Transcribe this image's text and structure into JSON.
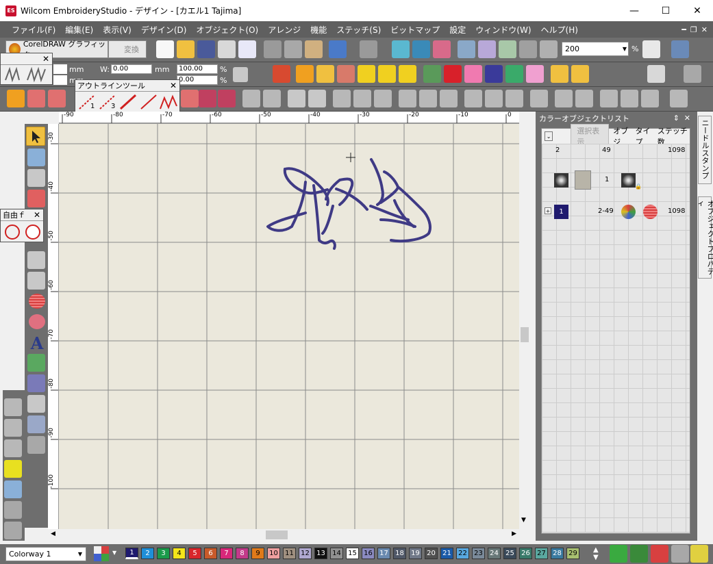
{
  "window": {
    "title": "Wilcom EmbroideryStudio - デザイン - [カエル1       Tajima]",
    "logo": "ES"
  },
  "menu": [
    "ファイル(F)",
    "編集(E)",
    "表示(V)",
    "デザイン(D)",
    "オブジェクト(O)",
    "アレンジ",
    "機能",
    "ステッチ(S)",
    "ビットマップ",
    "設定",
    "ウィンドウ(W)",
    "ヘルプ(H)"
  ],
  "toolbar": {
    "coreldraw_label": "CorelDRAW グラフィック",
    "convert_label": "変換",
    "zoom_value": "200",
    "zoom_unit": "%"
  },
  "props": {
    "unit1": "mm",
    "w_label": "W:",
    "w_value": "0.00",
    "unit2": "mm",
    "pct_value1": "100.00",
    "pct1": "%",
    "unit3": "mm",
    "val3": "0.00",
    "pct2": "%"
  },
  "outline_tools": {
    "title": "アウトラインツール",
    "num1": "1",
    "num2": "3"
  },
  "freehand": {
    "title": "自由ｆ"
  },
  "ruler": {
    "h_ticks": [
      "-90",
      "-80",
      "-70",
      "-60",
      "-50",
      "-40",
      "-30",
      "-20",
      "-10",
      "0"
    ],
    "v_ticks": [
      "-30",
      "-40",
      "-50",
      "-60",
      "-70",
      "-80",
      "-90",
      "-100"
    ]
  },
  "color_object_list": {
    "title": "カラーオブジェクトリスト",
    "filter_button": "選択表示",
    "columns": [
      "オブジ",
      "タイプ",
      "ステッチ数"
    ],
    "header_row": {
      "c1": "2",
      "c2": "49",
      "c3": "1098"
    },
    "row1": {
      "num": "1"
    },
    "row2": {
      "color_num": "1",
      "range": "2-49",
      "stitches": "1098"
    }
  },
  "side_tabs": [
    "ニードルスタンプ",
    "オブジェクトプロパティ"
  ],
  "status": {
    "colorway": "Colorway 1",
    "swatches": [
      {
        "n": "1",
        "c": "#1f1a6e",
        "fg": "#fff"
      },
      {
        "n": "2",
        "c": "#1f8fd8",
        "fg": "#fff"
      },
      {
        "n": "3",
        "c": "#1a9a4a",
        "fg": "#fff"
      },
      {
        "n": "4",
        "c": "#f4e51a",
        "fg": "#000"
      },
      {
        "n": "5",
        "c": "#d8262b",
        "fg": "#fff"
      },
      {
        "n": "6",
        "c": "#c85a2a",
        "fg": "#fff"
      },
      {
        "n": "7",
        "c": "#d8287a",
        "fg": "#fff"
      },
      {
        "n": "8",
        "c": "#c23a8a",
        "fg": "#fff"
      },
      {
        "n": "9",
        "c": "#e07a1a",
        "fg": "#000"
      },
      {
        "n": "10",
        "c": "#f0a0a0",
        "fg": "#000"
      },
      {
        "n": "11",
        "c": "#a09080",
        "fg": "#000"
      },
      {
        "n": "12",
        "c": "#b0a8d0",
        "fg": "#000"
      },
      {
        "n": "13",
        "c": "#101010",
        "fg": "#fff"
      },
      {
        "n": "14",
        "c": "#909090",
        "fg": "#000"
      },
      {
        "n": "15",
        "c": "#ffffff",
        "fg": "#000"
      },
      {
        "n": "16",
        "c": "#8a8ac0",
        "fg": "#000"
      },
      {
        "n": "17",
        "c": "#6a8ab0",
        "fg": "#fff"
      },
      {
        "n": "18",
        "c": "#505868",
        "fg": "#fff"
      },
      {
        "n": "19",
        "c": "#707888",
        "fg": "#fff"
      },
      {
        "n": "20",
        "c": "#505050",
        "fg": "#fff"
      },
      {
        "n": "21",
        "c": "#1a5aa8",
        "fg": "#fff"
      },
      {
        "n": "22",
        "c": "#58a8e0",
        "fg": "#000"
      },
      {
        "n": "23",
        "c": "#7a8a9a",
        "fg": "#000"
      },
      {
        "n": "24",
        "c": "#687878",
        "fg": "#fff"
      },
      {
        "n": "25",
        "c": "#3a4a5a",
        "fg": "#fff"
      },
      {
        "n": "26",
        "c": "#3a7a6a",
        "fg": "#fff"
      },
      {
        "n": "27",
        "c": "#5aa8a0",
        "fg": "#000"
      },
      {
        "n": "28",
        "c": "#3a7aa0",
        "fg": "#fff"
      },
      {
        "n": "29",
        "c": "#a8c070",
        "fg": "#000"
      }
    ]
  },
  "colors": {
    "thread": "#3f3a85",
    "canvas": "#ebe8dc",
    "chrome": "#6e6e6e"
  }
}
